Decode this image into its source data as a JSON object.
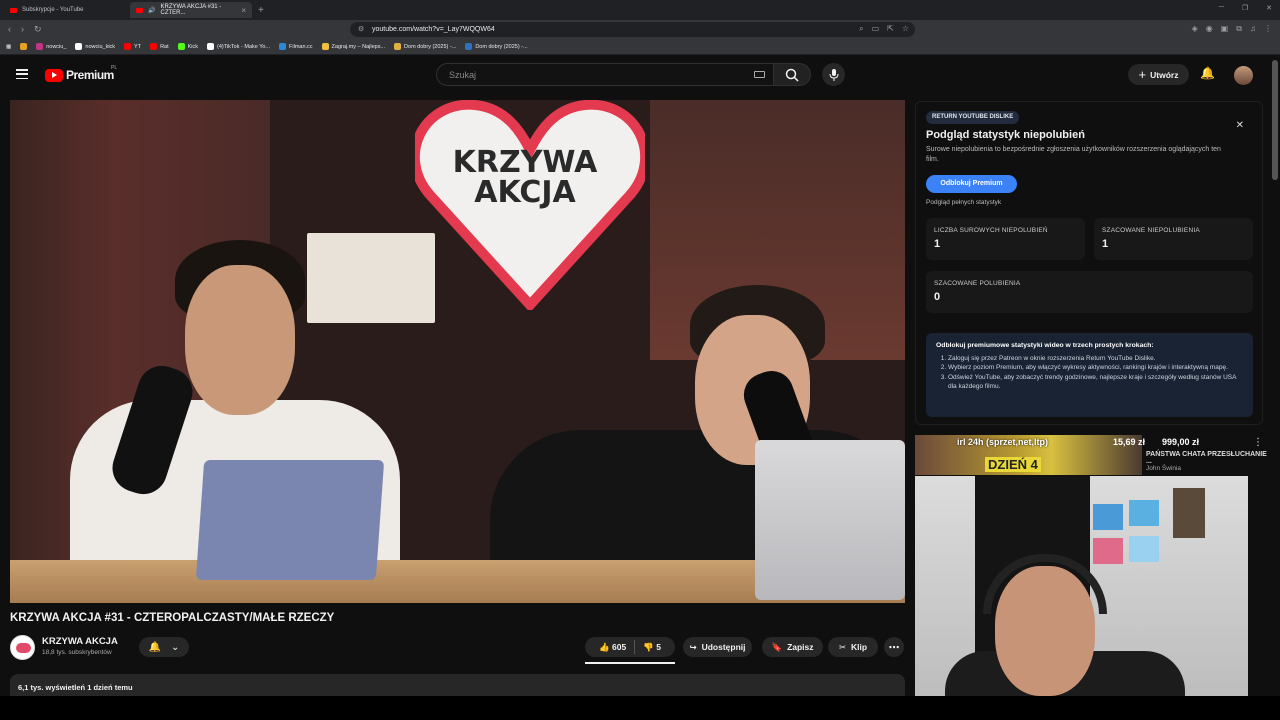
{
  "browser": {
    "tabs": [
      {
        "title": "Subskrypcje - YouTube"
      },
      {
        "title": "KRZYWA AKCJA #31 - CZTER..."
      }
    ],
    "url": "youtube.com/watch?v=_Lay7WQQW64",
    "bookmarks": [
      {
        "label": "nowciu_",
        "color": "#c13584"
      },
      {
        "label": "nowciu_kick",
        "color": "#ffffff"
      },
      {
        "label": "YT",
        "color": "#ff0000"
      },
      {
        "label": "Rat",
        "color": "#ff0000"
      },
      {
        "label": "Kick",
        "color": "#53fc18"
      },
      {
        "label": "(4)TikTok - Make Yo...",
        "color": "#ffffff"
      },
      {
        "label": "Filman.cc",
        "color": "#2a8ad8"
      },
      {
        "label": "Zagraj.my – Najleps...",
        "color": "#f0c040"
      },
      {
        "label": "Dom dobry (2025) -...",
        "color": "#e0b040"
      },
      {
        "label": "Dom dobry (2025) -...",
        "color": "#3070c0"
      }
    ]
  },
  "header": {
    "logo_text": "Premium",
    "logo_region": "PL",
    "search_placeholder": "Szukaj",
    "create_label": "Utwórz",
    "icons": [
      "hamburger-icon",
      "search-icon",
      "mic-icon",
      "bell-icon"
    ]
  },
  "video": {
    "heart_text": "KRZYWA AKCJA",
    "title": "KRZYWA AKCJA #31 - CZTEROPALCZASTY/MAŁE RZECZY",
    "channel_name": "KRZYWA AKCJA",
    "subscribers": "18,8 tys. subskrybentów",
    "likes": "605",
    "dislikes": "5",
    "share_label": "Udostępnij",
    "save_label": "Zapisz",
    "clip_label": "Klip",
    "meta": "6,1 tys. wyświetleń  1 dzień temu"
  },
  "dislike_panel": {
    "badge": "RETURN YOUTUBE DISLIKE",
    "title": "Podgląd statystyk niepolubień",
    "description": "Surowe niepolubienia to bezpośrednie zgłoszenia użytkowników rozszerzenia oglądających ten film.",
    "unlock_button": "Odblokuj Premium",
    "preview_link": "Podgląd pełnych statystyk",
    "stats": [
      {
        "label": "LICZBA SUROWYCH NIEPOLUBIEŃ",
        "value": "1"
      },
      {
        "label": "SZACOWANE NIEPOLUBIENIA",
        "value": "1"
      },
      {
        "label": "SZACOWANE POLUBIENIA",
        "value": "0"
      }
    ],
    "steps_title": "Odblokuj premiumowe statystyki wideo w trzech prostych krokach:",
    "steps": [
      "Zaloguj się przez Patreon w oknie rozszerzenia Return YouTube Dislike.",
      "Wybierz poziom Premium, aby włączyć wykresy aktywności, rankingi krajów i interaktywną mapę.",
      "Odśwież YouTube, aby zobaczyć trendy godzinowe, najlepsze kraje i szczegóły według stanów USA dla każdego filmu."
    ]
  },
  "related": {
    "overlay_top": "irl 24h (sprzet,net,ltp)",
    "overlay_main": "DZIEŃ 4",
    "price1": "15,69 zł",
    "price2": "999,00 zł",
    "title": "PAŃSTWA CHATA PRZESŁUCHANIE ...",
    "channel": "John Świnia"
  }
}
